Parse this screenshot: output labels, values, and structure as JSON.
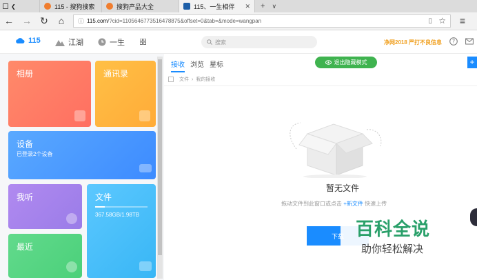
{
  "browser": {
    "tabs": [
      {
        "label": "115 - 搜狗搜索",
        "color": "#f07d2e",
        "active": false
      },
      {
        "label": "搜狗产品大全",
        "color": "#f07d2e",
        "active": false
      },
      {
        "label": "115、一生相伴",
        "color": "#1e5fa8",
        "active": true
      }
    ],
    "new_tab": "+",
    "tab_menu": "∨",
    "url_host": "115.com",
    "url_rest": "/?cid=1105646773516478875&offset=0&tab=&mode=wangpan"
  },
  "header": {
    "logo_text": "115",
    "nav": [
      "江湖",
      "一生"
    ],
    "search_placeholder": "搜索",
    "promo": "净网2018 严打不良信息",
    "accent": "#1a8cff"
  },
  "tiles": [
    {
      "title": "相册",
      "subtitle": "",
      "icon": "image-icon",
      "color": "#ff6f61"
    },
    {
      "title": "通讯录",
      "subtitle": "",
      "icon": "contact-icon",
      "color": "#ffb238"
    },
    {
      "title": "设备",
      "subtitle": "已登录2个设备",
      "icon": "monitor-icon",
      "color": "#3d8bff"
    },
    {
      "title": "我听",
      "subtitle": "",
      "icon": "play-icon",
      "color": "#9a7ce8"
    },
    {
      "title": "文件",
      "subtitle": "367.58GB/1.98TB",
      "icon": "folder-icon",
      "color": "#38b6f5",
      "usage_fraction": 0.18
    },
    {
      "title": "最近",
      "subtitle": "",
      "icon": "clock-icon",
      "color": "#4bd07a"
    }
  ],
  "main": {
    "tabs": [
      "接收",
      "浏览",
      "星标"
    ],
    "active_tab": "接收",
    "hidden_mode_button": "退出隐藏模式",
    "breadcrumb": [
      "文件",
      "我的接收"
    ],
    "empty_title": "暂无文件",
    "empty_desc_pre": "拖动文件到此窗口或点击",
    "empty_desc_link": "+新文件",
    "empty_desc_post": "快速上传",
    "download_button": "下载"
  },
  "watermark": {
    "line1": "百科全说",
    "line2": "助你轻松解决"
  }
}
